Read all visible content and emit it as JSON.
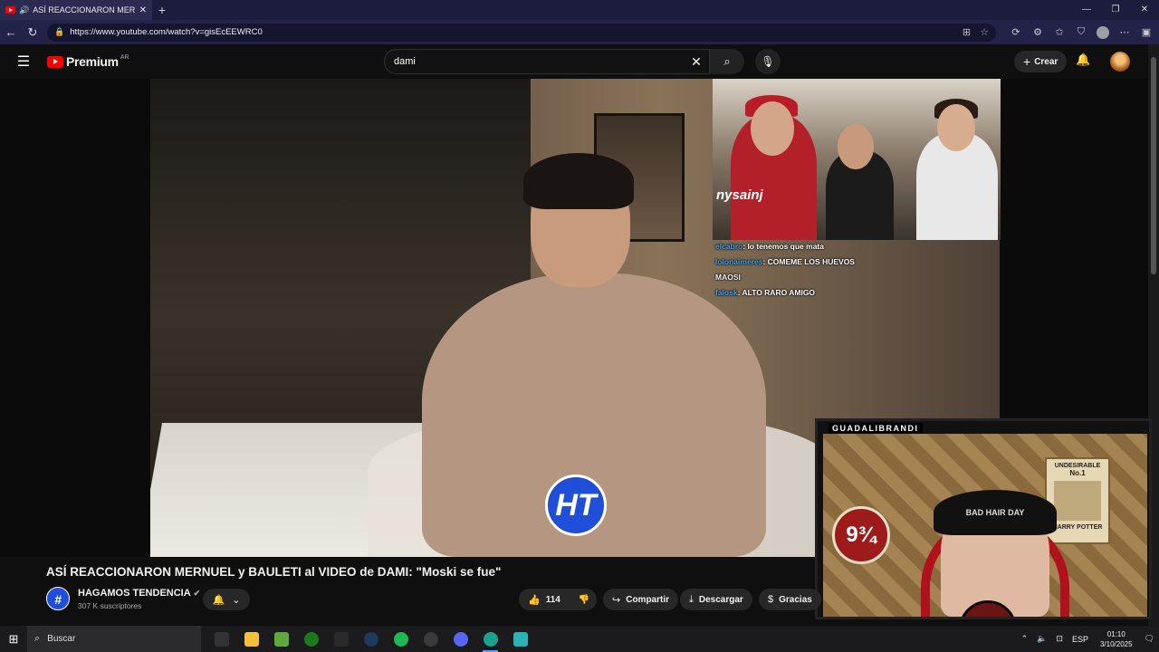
{
  "browser": {
    "tab_title": "ASÍ REACCIONARON MERNUEL",
    "url": "https://www.youtube.com/watch?v=gisEcEEWRC0"
  },
  "youtube": {
    "logo_text": "Premium",
    "region": "AR",
    "search_value": "dami",
    "create_label": "Crear"
  },
  "video": {
    "chat": [
      {
        "user": "elcabro",
        "text": ": lo tenemos que mata"
      },
      {
        "user": "lolonaimeres",
        "text": ": COMEME LOS HUEVOS"
      },
      {
        "user": "MAOSI",
        "text": ""
      },
      {
        "user": "falosk",
        "text": ": ALTO RARO AMIGO"
      }
    ],
    "cam_brand": "nysainj",
    "streamer_tag": "GUADALIBRANDI",
    "poster_text": [
      "UNDESIRABLE",
      "No.1",
      "HARRY POTTER"
    ],
    "platform_text": "9¾",
    "beanie_text": "BAD HAIR DAY",
    "overlay_logo": "HT"
  },
  "meta": {
    "title": "ASÍ REACCIONARON MERNUEL y BAULETI al VIDEO de DAMI: \"Moski se fue\"",
    "channel": "HAGAMOS TENDENCIA",
    "subscribers": "307 K suscriptores",
    "likes": "114",
    "share_label": "Compartir",
    "download_label": "Descargar",
    "thanks_label": "Gracias"
  },
  "taskbar": {
    "search_label": "Buscar",
    "lang": "ESP",
    "time": "01:10",
    "date": "3/10/2025"
  },
  "colors": {
    "youtube_red": "#ff0000",
    "channel_blue": "#1f4fd8",
    "browser_frame": "#1c1c3c"
  }
}
